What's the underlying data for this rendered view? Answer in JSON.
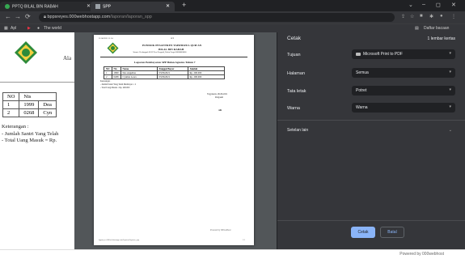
{
  "browser": {
    "tabs": [
      {
        "label": "PPTQ BILAL BIN RABAH"
      },
      {
        "label": "SPP"
      }
    ],
    "new_tab": "+",
    "window_controls": [
      "⌄",
      "–",
      "◻",
      "✕"
    ],
    "url_host": "bppsreyes.000webhostapp.com",
    "url_path": "/laporan/laporan_spp",
    "bookmarks": [
      {
        "label": "Apl"
      },
      {
        "label": "The world"
      }
    ],
    "reading_list": "Daftar bacaan"
  },
  "page": {
    "alamat_fragment": "Ala",
    "table": {
      "headers": [
        "NO",
        "Nis"
      ],
      "rows": [
        [
          "1",
          "1999",
          "Dea"
        ],
        [
          "2",
          "0268",
          "Cyn"
        ]
      ]
    },
    "keterangan_title": "Keterangan :",
    "keterangan_lines": [
      "- Jumlah Santri Yang Telah",
      "- Total Uang Masuk = Rp."
    ]
  },
  "preview": {
    "date_top": "11/06/2021 11.34",
    "page_title_top": "SPP",
    "institution": "PONDOK PESANTREN TAHFIDZUL QUR'AN",
    "institution2": "BILAL BIN RABAH",
    "address": "Alamat : Kedungpoh 05/03 Desa Pengasih, Kulon Progo 000000000000",
    "report_title": "Laporan Pembayaran SPP Bulan Agustus Tahun 7",
    "table": {
      "headers": [
        "NO",
        "Nis",
        "Nama",
        "Tanggal Bayar",
        "Jumlah"
      ],
      "rows": [
        [
          "1",
          "1999",
          "Dea Angelina",
          "03/06/2021",
          "Rp. 200.000"
        ],
        [
          "2",
          "0268",
          "Cynthia Leora",
          "03/06/2021",
          "Rp. 200.000"
        ]
      ]
    },
    "notes": [
      "Keterangan :",
      "- Jumlah Santri Yang Telah Membayar = 2",
      "- Total Uang Masuk = Rp. 400.000"
    ],
    "sign_place": "Yogyakarta, 06-06-2021",
    "sign_role": "Pengasuh",
    "sign_name": "Abi",
    "footer_url": "bppsreyes.000webhostapp.com/laporan/laporan_spp",
    "footer_page": "1/1",
    "watermark": "Powered by 000webhost"
  },
  "print_panel": {
    "title": "Cetak",
    "sheet_count": "1 lembar kertas",
    "fields": [
      {
        "label": "Tujuan",
        "value": "Microsoft Print to PDF"
      },
      {
        "label": "Halaman",
        "value": "Semua"
      },
      {
        "label": "Tata letak",
        "value": "Potret"
      },
      {
        "label": "Warna",
        "value": "Warna"
      }
    ],
    "more_settings": "Setelan lain",
    "print_button": "Cetak",
    "cancel_button": "Batal"
  },
  "footer": {
    "powered": "Powered by 000webhost"
  }
}
